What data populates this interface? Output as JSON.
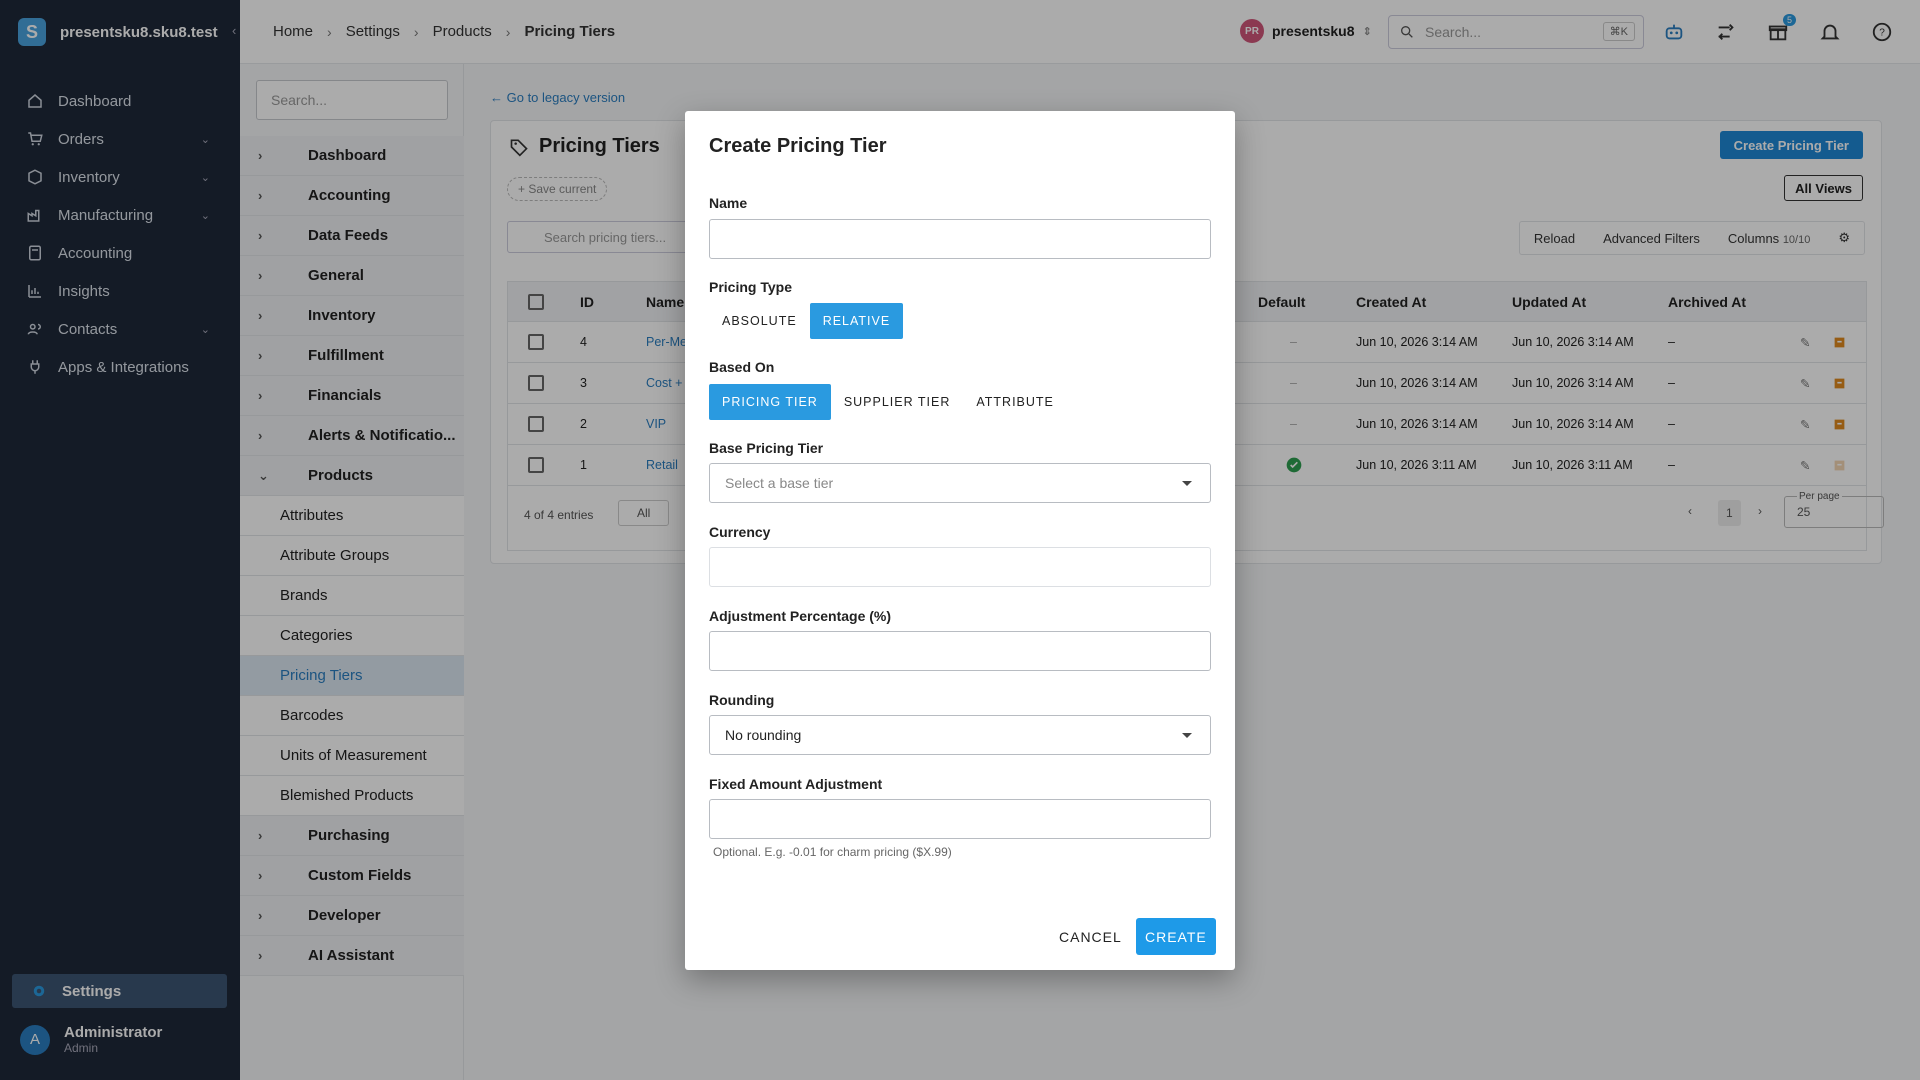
{
  "app": {
    "workspace": "presentsku8.sku8.test",
    "logo_letter": "S"
  },
  "sidebar": {
    "items": [
      {
        "label": "Dashboard",
        "icon": "home-icon",
        "has_chevron": false
      },
      {
        "label": "Orders",
        "icon": "cart-icon",
        "has_chevron": true
      },
      {
        "label": "Inventory",
        "icon": "box-icon",
        "has_chevron": true
      },
      {
        "label": "Manufacturing",
        "icon": "factory-icon",
        "has_chevron": true
      },
      {
        "label": "Accounting",
        "icon": "calculator-icon",
        "has_chevron": false
      },
      {
        "label": "Insights",
        "icon": "chart-icon",
        "has_chevron": false
      },
      {
        "label": "Contacts",
        "icon": "contacts-icon",
        "has_chevron": true
      },
      {
        "label": "Apps & Integrations",
        "icon": "plug-icon",
        "has_chevron": false
      }
    ],
    "settings_label": "Settings",
    "user": {
      "initial": "A",
      "name": "Administrator",
      "role": "Admin"
    }
  },
  "header": {
    "breadcrumbs": [
      "Home",
      "Settings",
      "Products",
      "Pricing Tiers"
    ],
    "account": {
      "initials": "PR",
      "name": "presentsku8"
    },
    "search_placeholder": "Search...",
    "shortcut": "⌘K",
    "gift_badge": "5"
  },
  "submenu": {
    "search_placeholder": "Search...",
    "items": [
      {
        "label": "Dashboard",
        "type": "hdr",
        "chev": "›"
      },
      {
        "label": "Accounting",
        "type": "hdr",
        "chev": "›"
      },
      {
        "label": "Data Feeds",
        "type": "hdr",
        "chev": "›"
      },
      {
        "label": "General",
        "type": "hdr",
        "chev": "›"
      },
      {
        "label": "Inventory",
        "type": "hdr",
        "chev": "›"
      },
      {
        "label": "Fulfillment",
        "type": "hdr",
        "chev": "›"
      },
      {
        "label": "Financials",
        "type": "hdr",
        "chev": "›"
      },
      {
        "label": "Alerts & Notificatio...",
        "type": "hdr",
        "chev": "›"
      },
      {
        "label": "Products",
        "type": "hdr",
        "chev": "⌄"
      },
      {
        "label": "Attributes",
        "type": "child"
      },
      {
        "label": "Attribute Groups",
        "type": "child"
      },
      {
        "label": "Brands",
        "type": "child"
      },
      {
        "label": "Categories",
        "type": "child"
      },
      {
        "label": "Pricing Tiers",
        "type": "child active"
      },
      {
        "label": "Barcodes",
        "type": "child"
      },
      {
        "label": "Units of Measurement",
        "type": "child"
      },
      {
        "label": "Blemished Products",
        "type": "child"
      },
      {
        "label": "Purchasing",
        "type": "hdr",
        "chev": "›"
      },
      {
        "label": "Custom Fields",
        "type": "hdr",
        "chev": "›"
      },
      {
        "label": "Developer",
        "type": "hdr",
        "chev": "›"
      },
      {
        "label": "AI Assistant",
        "type": "hdr",
        "chev": "›"
      }
    ]
  },
  "main": {
    "legacy_link": "← Go to legacy version",
    "title": "Pricing Tiers",
    "create_button": "Create Pricing Tier",
    "save_current": "+ Save current",
    "all_views": "All Views",
    "table_search_placeholder": "Search pricing tiers...",
    "toolbar": {
      "reload": "Reload",
      "filters": "Advanced Filters",
      "columns": "Columns",
      "columns_count": "10/10"
    },
    "columns": {
      "id": "ID",
      "name": "Name",
      "default": "Default",
      "created": "Created At",
      "updated": "Updated At",
      "archived": "Archived At"
    },
    "rows": [
      {
        "id": "4",
        "name": "Per-Me",
        "default": "–",
        "created": "Jun 10, 2026 3:14 AM",
        "updated": "Jun 10, 2026 3:14 AM",
        "archived": "–"
      },
      {
        "id": "3",
        "name": "Cost +",
        "default": "–",
        "created": "Jun 10, 2026 3:14 AM",
        "updated": "Jun 10, 2026 3:14 AM",
        "archived": "–"
      },
      {
        "id": "2",
        "name": "VIP",
        "default": "–",
        "created": "Jun 10, 2026 3:14 AM",
        "updated": "Jun 10, 2026 3:14 AM",
        "archived": "–"
      },
      {
        "id": "1",
        "name": "Retail",
        "default": "check",
        "created": "Jun 10, 2026 3:11 AM",
        "updated": "Jun 10, 2026 3:11 AM",
        "archived": "–"
      }
    ],
    "entries": "4 of 4 entries",
    "filter_all": "All",
    "page": "1",
    "per_page_label": "Per page",
    "per_page": "25"
  },
  "modal": {
    "title": "Create Pricing Tier",
    "name_label": "Name",
    "name_value": "",
    "pricing_type_label": "Pricing Type",
    "pricing_type_options": [
      "ABSOLUTE",
      "RELATIVE"
    ],
    "pricing_type_selected": "RELATIVE",
    "based_on_label": "Based On",
    "based_on_options": [
      "PRICING TIER",
      "SUPPLIER TIER",
      "ATTRIBUTE"
    ],
    "based_on_selected": "PRICING TIER",
    "base_tier_label": "Base Pricing Tier",
    "base_tier_placeholder": "Select a base tier",
    "currency_label": "Currency",
    "currency_value": "",
    "adjustment_label": "Adjustment Percentage (%)",
    "adjustment_value": "",
    "rounding_label": "Rounding",
    "rounding_value": "No rounding",
    "fixed_label": "Fixed Amount Adjustment",
    "fixed_value": "",
    "fixed_help": "Optional. E.g. -0.01 for charm pricing ($X.99)",
    "cancel": "CANCEL",
    "create": "CREATE"
  },
  "colors": {
    "accent": "#1e9ae8",
    "sidebar_bg": "#1e2939",
    "overlay": "rgba(0,0,0,0.33)"
  }
}
